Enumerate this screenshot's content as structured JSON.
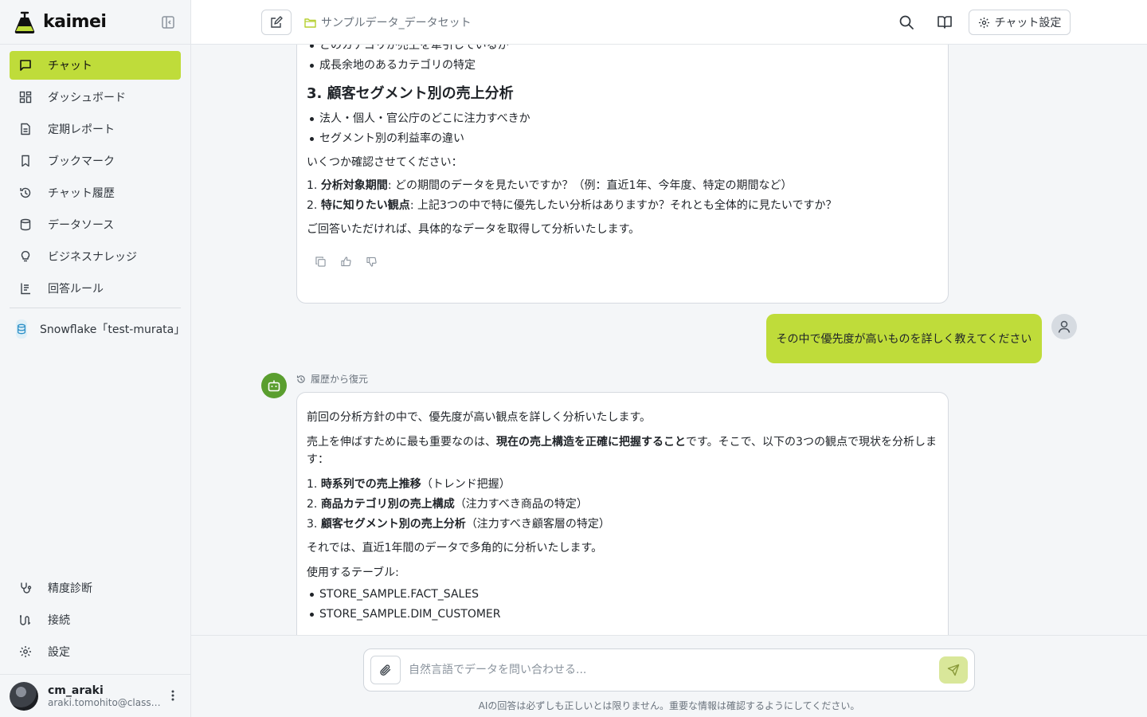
{
  "brand": {
    "name": "kaimei"
  },
  "sidebar": {
    "items": [
      {
        "label": "チャット",
        "icon": "chat-icon",
        "active": true
      },
      {
        "label": "ダッシュボード",
        "icon": "dashboard-icon"
      },
      {
        "label": "定期レポート",
        "icon": "report-icon"
      },
      {
        "label": "ブックマーク",
        "icon": "bookmark-icon"
      },
      {
        "label": "チャット履歴",
        "icon": "history-icon"
      },
      {
        "label": "データソース",
        "icon": "database-icon"
      },
      {
        "label": "ビジネスナレッジ",
        "icon": "lightbulb-icon"
      },
      {
        "label": "回答ルール",
        "icon": "rules-icon"
      }
    ],
    "datasource": {
      "label": "Snowflake「test-murata」",
      "icon": "snowflake-db-icon"
    },
    "bottom_items": [
      {
        "label": "精度診断",
        "icon": "stethoscope-icon"
      },
      {
        "label": "接続",
        "icon": "connection-icon"
      },
      {
        "label": "設定",
        "icon": "gear-icon"
      }
    ],
    "user": {
      "name": "cm_araki",
      "email": "araki.tomohito@classmethod.jp"
    }
  },
  "header": {
    "dataset": "サンプルデータ_データセット",
    "settings_label": "チャット設定"
  },
  "messages": {
    "card1": {
      "top_partial": "どのカテゴリが売上を牽引しているか",
      "bullet_growth": "成長余地のあるカテゴリの特定",
      "heading3": "3. 顧客セグメント別の売上分析",
      "seg_bullets": [
        "法人・個人・官公庁のどこに注力すべきか",
        "セグメント別の利益率の違い"
      ],
      "confirm_intro": "いくつか確認させてください：",
      "q1_num": "1. ",
      "q1_bold": "分析対象期間",
      "q1_text": ": どの期間のデータを見たいですか？（例：直近1年、今年度、特定の期間など）",
      "q2_num": "2. ",
      "q2_bold": "特に知りたい観点",
      "q2_text": ": 上記3つの中で特に優先したい分析はありますか？それとも全体的に見たいですか？",
      "closing": "ご回答いただければ、具体的なデータを取得して分析いたします。"
    },
    "user_message": "その中で優先度が高いものを詳しく教えてください",
    "restore_label": "履歴から復元",
    "card2": {
      "intro": "前回の分析方針の中で、優先度が高い観点を詳しく分析いたします。",
      "p2_before": "売上を伸ばすために最も重要なのは、",
      "p2_bold": "現在の売上構造を正確に把握すること",
      "p2_after": "です。そこで、以下の3つの観点で現状を分析します：",
      "points": [
        {
          "num": "1. ",
          "bold": "時系列での売上推移",
          "text": "（トレンド把握）"
        },
        {
          "num": "2. ",
          "bold": "商品カテゴリ別の売上構成",
          "text": "（注力すべき商品の特定）"
        },
        {
          "num": "3. ",
          "bold": "顧客セグメント別の売上分析",
          "text": "（注力すべき顧客層の特定）"
        }
      ],
      "plan": "それでは、直近1年間のデータで多角的に分析いたします。",
      "tables_label": "使用するテーブル:",
      "tables": [
        "STORE_SAMPLE.FACT_SALES",
        "STORE_SAMPLE.DIM_CUSTOMER"
      ]
    }
  },
  "composer": {
    "placeholder": "自然言語でデータを問い合わせる...",
    "disclaimer": "AIの回答は必ずしも正しいとは限りません。重要な情報は確認するようにしてください。"
  },
  "colors": {
    "accent": "#bfdc3a",
    "bot": "#5a9e2f",
    "sidebar_bg": "#f4f6f8"
  }
}
